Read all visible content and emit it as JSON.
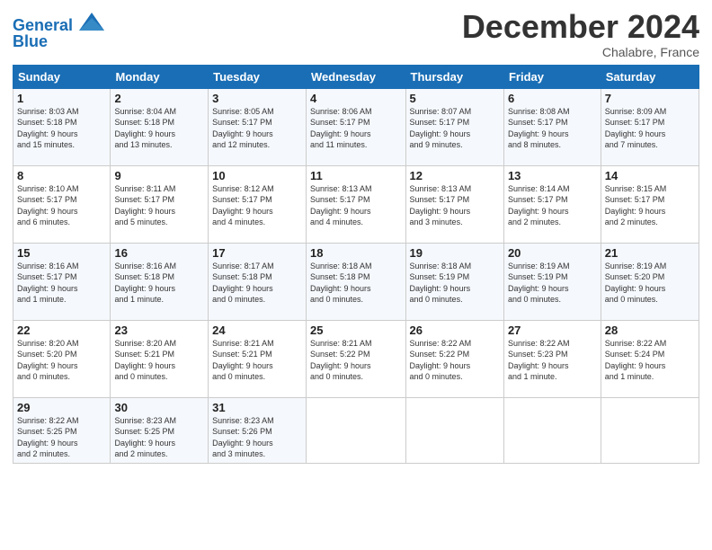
{
  "header": {
    "logo_text_general": "General",
    "logo_text_blue": "Blue",
    "month_title": "December 2024",
    "location": "Chalabre, France"
  },
  "days_of_week": [
    "Sunday",
    "Monday",
    "Tuesday",
    "Wednesday",
    "Thursday",
    "Friday",
    "Saturday"
  ],
  "weeks": [
    [
      {
        "day": "1",
        "info": "Sunrise: 8:03 AM\nSunset: 5:18 PM\nDaylight: 9 hours\nand 15 minutes."
      },
      {
        "day": "2",
        "info": "Sunrise: 8:04 AM\nSunset: 5:18 PM\nDaylight: 9 hours\nand 13 minutes."
      },
      {
        "day": "3",
        "info": "Sunrise: 8:05 AM\nSunset: 5:17 PM\nDaylight: 9 hours\nand 12 minutes."
      },
      {
        "day": "4",
        "info": "Sunrise: 8:06 AM\nSunset: 5:17 PM\nDaylight: 9 hours\nand 11 minutes."
      },
      {
        "day": "5",
        "info": "Sunrise: 8:07 AM\nSunset: 5:17 PM\nDaylight: 9 hours\nand 9 minutes."
      },
      {
        "day": "6",
        "info": "Sunrise: 8:08 AM\nSunset: 5:17 PM\nDaylight: 9 hours\nand 8 minutes."
      },
      {
        "day": "7",
        "info": "Sunrise: 8:09 AM\nSunset: 5:17 PM\nDaylight: 9 hours\nand 7 minutes."
      }
    ],
    [
      {
        "day": "8",
        "info": "Sunrise: 8:10 AM\nSunset: 5:17 PM\nDaylight: 9 hours\nand 6 minutes."
      },
      {
        "day": "9",
        "info": "Sunrise: 8:11 AM\nSunset: 5:17 PM\nDaylight: 9 hours\nand 5 minutes."
      },
      {
        "day": "10",
        "info": "Sunrise: 8:12 AM\nSunset: 5:17 PM\nDaylight: 9 hours\nand 4 minutes."
      },
      {
        "day": "11",
        "info": "Sunrise: 8:13 AM\nSunset: 5:17 PM\nDaylight: 9 hours\nand 4 minutes."
      },
      {
        "day": "12",
        "info": "Sunrise: 8:13 AM\nSunset: 5:17 PM\nDaylight: 9 hours\nand 3 minutes."
      },
      {
        "day": "13",
        "info": "Sunrise: 8:14 AM\nSunset: 5:17 PM\nDaylight: 9 hours\nand 2 minutes."
      },
      {
        "day": "14",
        "info": "Sunrise: 8:15 AM\nSunset: 5:17 PM\nDaylight: 9 hours\nand 2 minutes."
      }
    ],
    [
      {
        "day": "15",
        "info": "Sunrise: 8:16 AM\nSunset: 5:17 PM\nDaylight: 9 hours\nand 1 minute."
      },
      {
        "day": "16",
        "info": "Sunrise: 8:16 AM\nSunset: 5:18 PM\nDaylight: 9 hours\nand 1 minute."
      },
      {
        "day": "17",
        "info": "Sunrise: 8:17 AM\nSunset: 5:18 PM\nDaylight: 9 hours\nand 0 minutes."
      },
      {
        "day": "18",
        "info": "Sunrise: 8:18 AM\nSunset: 5:18 PM\nDaylight: 9 hours\nand 0 minutes."
      },
      {
        "day": "19",
        "info": "Sunrise: 8:18 AM\nSunset: 5:19 PM\nDaylight: 9 hours\nand 0 minutes."
      },
      {
        "day": "20",
        "info": "Sunrise: 8:19 AM\nSunset: 5:19 PM\nDaylight: 9 hours\nand 0 minutes."
      },
      {
        "day": "21",
        "info": "Sunrise: 8:19 AM\nSunset: 5:20 PM\nDaylight: 9 hours\nand 0 minutes."
      }
    ],
    [
      {
        "day": "22",
        "info": "Sunrise: 8:20 AM\nSunset: 5:20 PM\nDaylight: 9 hours\nand 0 minutes."
      },
      {
        "day": "23",
        "info": "Sunrise: 8:20 AM\nSunset: 5:21 PM\nDaylight: 9 hours\nand 0 minutes."
      },
      {
        "day": "24",
        "info": "Sunrise: 8:21 AM\nSunset: 5:21 PM\nDaylight: 9 hours\nand 0 minutes."
      },
      {
        "day": "25",
        "info": "Sunrise: 8:21 AM\nSunset: 5:22 PM\nDaylight: 9 hours\nand 0 minutes."
      },
      {
        "day": "26",
        "info": "Sunrise: 8:22 AM\nSunset: 5:22 PM\nDaylight: 9 hours\nand 0 minutes."
      },
      {
        "day": "27",
        "info": "Sunrise: 8:22 AM\nSunset: 5:23 PM\nDaylight: 9 hours\nand 1 minute."
      },
      {
        "day": "28",
        "info": "Sunrise: 8:22 AM\nSunset: 5:24 PM\nDaylight: 9 hours\nand 1 minute."
      }
    ],
    [
      {
        "day": "29",
        "info": "Sunrise: 8:22 AM\nSunset: 5:25 PM\nDaylight: 9 hours\nand 2 minutes."
      },
      {
        "day": "30",
        "info": "Sunrise: 8:23 AM\nSunset: 5:25 PM\nDaylight: 9 hours\nand 2 minutes."
      },
      {
        "day": "31",
        "info": "Sunrise: 8:23 AM\nSunset: 5:26 PM\nDaylight: 9 hours\nand 3 minutes."
      },
      null,
      null,
      null,
      null
    ]
  ]
}
